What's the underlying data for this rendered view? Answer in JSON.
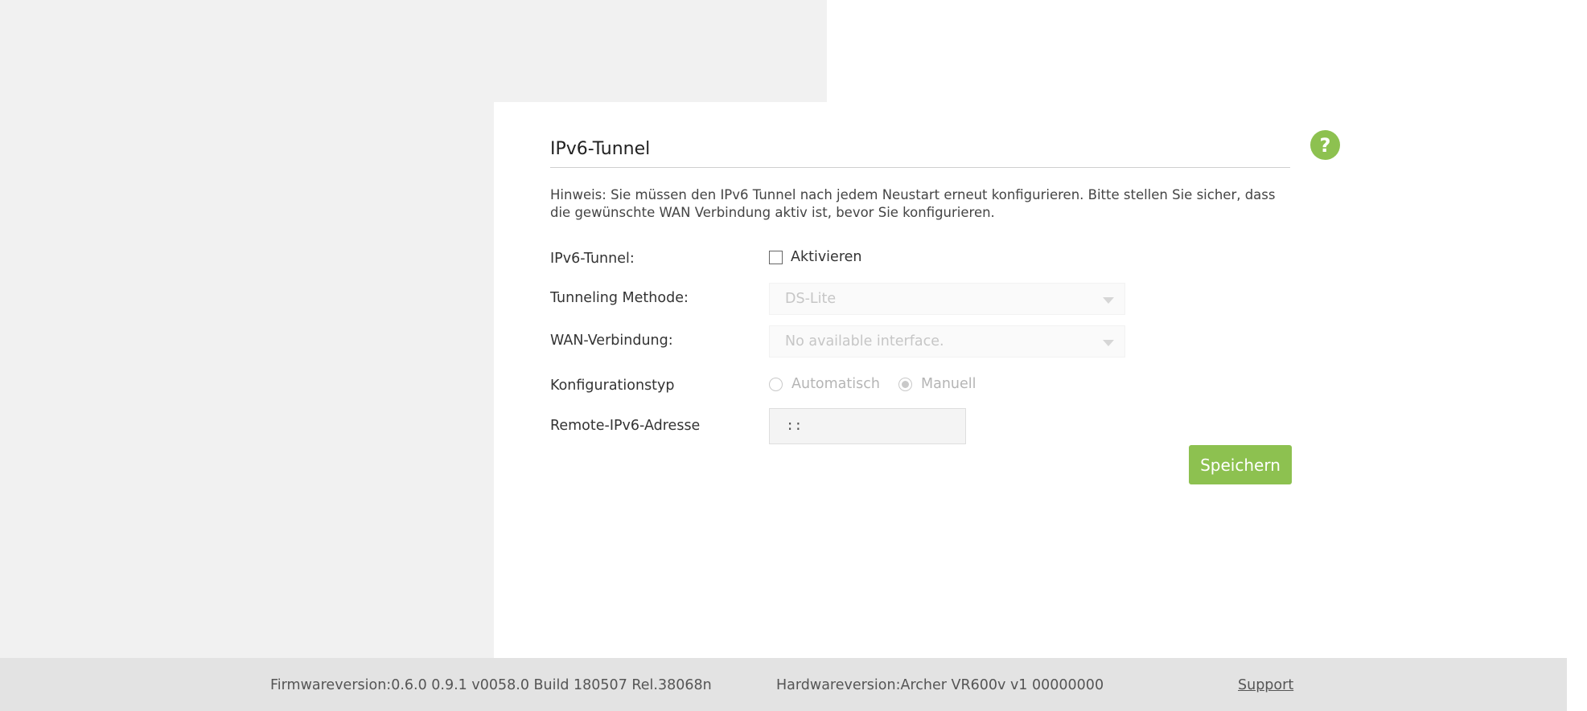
{
  "panel": {
    "title": "IPv6-Tunnel",
    "hint": "Hinweis: Sie müssen den IPv6 Tunnel nach jedem Neustart erneut konfigurieren. Bitte stellen Sie sicher, dass die gewünschte WAN Verbindung aktiv ist, bevor Sie konfigurieren."
  },
  "help_icon": {
    "glyph": "?",
    "icon": "help-icon",
    "color": "#8dc150"
  },
  "form": {
    "tunnel": {
      "label": "IPv6-Tunnel:",
      "checkbox_label": "Aktivieren",
      "checked": false
    },
    "method": {
      "label": "Tunneling Methode:",
      "value": "DS-Lite"
    },
    "wan": {
      "label": "WAN-Verbindung:",
      "value": "No available interface."
    },
    "config_type": {
      "label": "Konfigurationstyp",
      "options": [
        {
          "label": "Automatisch",
          "selected": false
        },
        {
          "label": "Manuell",
          "selected": true
        }
      ]
    },
    "remote": {
      "label": "Remote-IPv6-Adresse",
      "value": "::"
    }
  },
  "save_label": "Speichern",
  "footer": {
    "firmware": "Firmwareversion:0.6.0 0.9.1 v0058.0 Build 180507 Rel.38068n",
    "hardware": "Hardwareversion:Archer VR600v v1 00000000",
    "support": "Support"
  },
  "colors": {
    "accent": "#8dc150",
    "background": "#f1f1f1",
    "footer": "#e3e3e3"
  }
}
